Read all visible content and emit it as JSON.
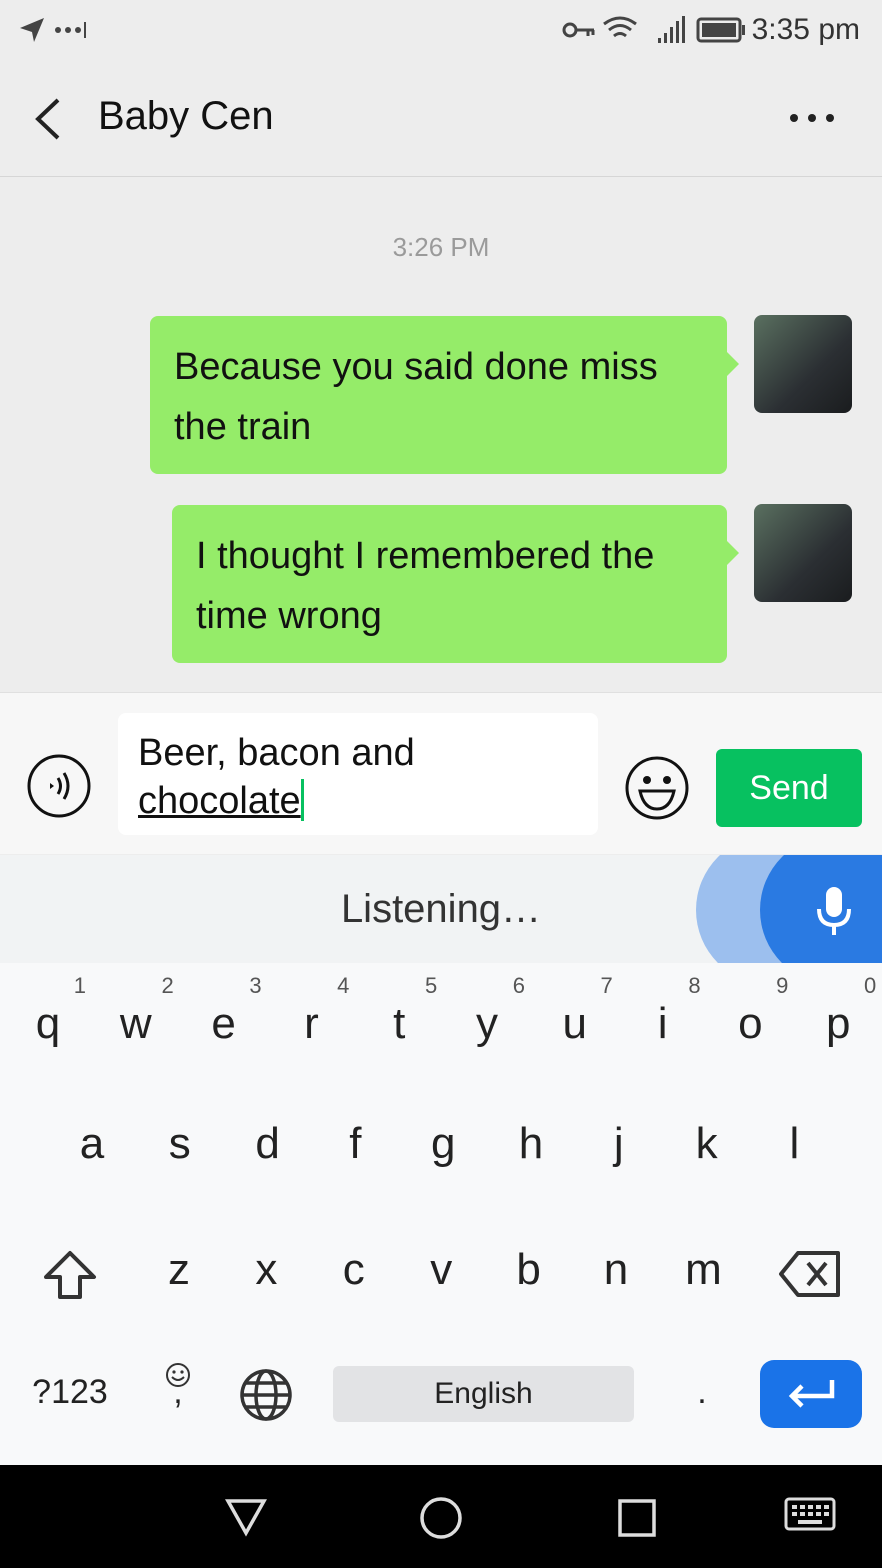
{
  "status_bar": {
    "time": "3:35 pm",
    "icons": [
      "send-icon",
      "more-dots-icon",
      "key-icon",
      "wifi-icon",
      "signal-icon",
      "battery-icon"
    ]
  },
  "header": {
    "title": "Baby Cen",
    "back_icon": "chevron-left-icon",
    "menu_icon": "more-horizontal-icon"
  },
  "chat": {
    "timestamp": "3:26 PM",
    "messages": [
      {
        "text": "Because you said done miss the train",
        "sender": "me"
      },
      {
        "text": "I thought I remembered the time wrong",
        "sender": "me"
      }
    ]
  },
  "input": {
    "value_line1": "Beer, bacon and",
    "value_line2": "chocolate",
    "send_label": "Send"
  },
  "voice": {
    "status": "Listening…"
  },
  "keyboard": {
    "row1": [
      [
        "q",
        "1"
      ],
      [
        "w",
        "2"
      ],
      [
        "e",
        "3"
      ],
      [
        "r",
        "4"
      ],
      [
        "t",
        "5"
      ],
      [
        "y",
        "6"
      ],
      [
        "u",
        "7"
      ],
      [
        "i",
        "8"
      ],
      [
        "o",
        "9"
      ],
      [
        "p",
        "0"
      ]
    ],
    "row2": [
      "a",
      "s",
      "d",
      "f",
      "g",
      "h",
      "j",
      "k",
      "l"
    ],
    "row3": [
      "z",
      "x",
      "c",
      "v",
      "b",
      "n",
      "m"
    ],
    "symbols_label": "?123",
    "comma": ",",
    "space_label": "English",
    "period": "."
  },
  "colors": {
    "bubble": "#95ec69",
    "send": "#07c160",
    "mic": "#2a7ae2",
    "enter": "#1a73e8"
  }
}
